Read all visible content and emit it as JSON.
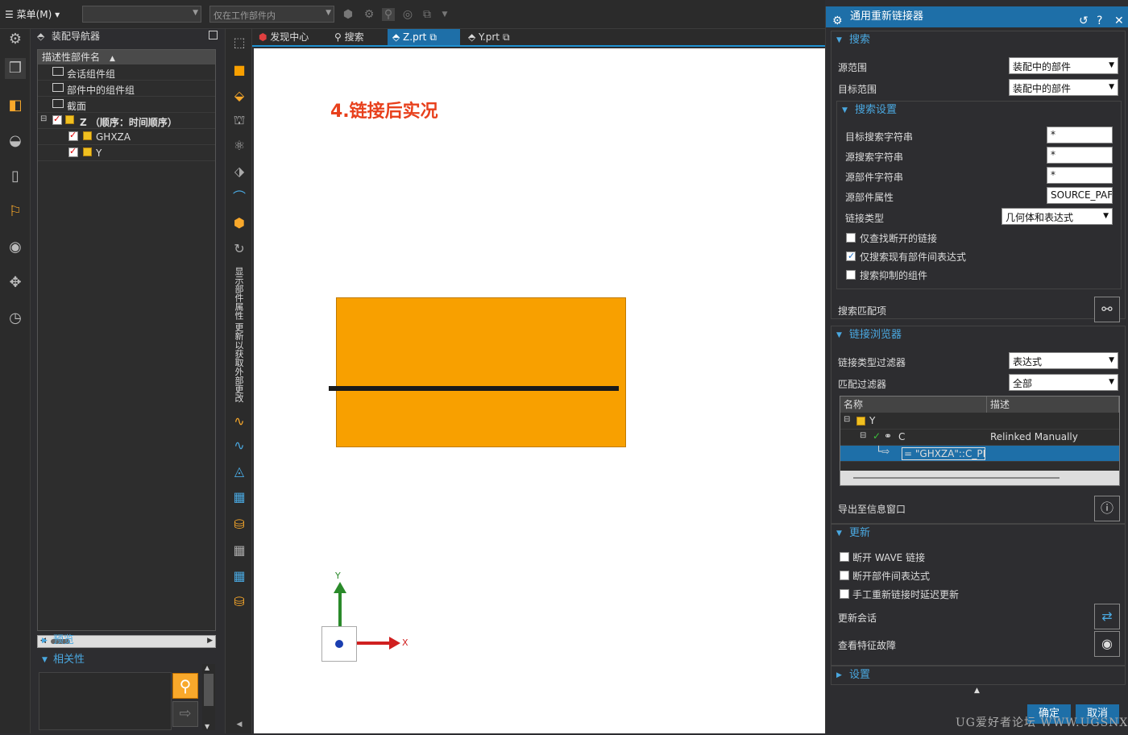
{
  "topbar": {
    "menu_label": "☰ 菜单(M) ▾",
    "filter1_value": "",
    "filter2_value": "仅在工作部件内"
  },
  "navigator": {
    "title": "装配导航器",
    "column_header": "描述性部件名",
    "rows": [
      {
        "label": "会话组件组"
      },
      {
        "label": "部件中的组件组"
      },
      {
        "label": "截面"
      },
      {
        "label": "Z （顺序：时间顺序）"
      },
      {
        "label": "GHXZA"
      },
      {
        "label": "Y"
      }
    ],
    "preview_label": "预览",
    "dependency_label": "相关性"
  },
  "vertical_toolbar": {
    "text": "显示部件属性 更新以获取外部更改"
  },
  "tabs": [
    {
      "label": "发现中心"
    },
    {
      "label": "搜索"
    },
    {
      "label": "Z.prt"
    },
    {
      "label": "Y.prt"
    }
  ],
  "canvas": {
    "heading": "4.链接后实况",
    "axis_x": "X",
    "axis_y": "Y"
  },
  "dialog": {
    "title": "通用重新链接器",
    "search": {
      "header": "搜索",
      "source_scope_label": "源范围",
      "source_scope_value": "装配中的部件",
      "target_scope_label": "目标范围",
      "target_scope_value": "装配中的部件",
      "settings_header": "搜索设置",
      "target_search_label": "目标搜索字符串",
      "target_search_value": "*",
      "source_search_label": "源搜索字符串",
      "source_search_value": "*",
      "source_part_label": "源部件字符串",
      "source_part_value": "*",
      "source_attr_label": "源部件属性",
      "source_attr_value": "SOURCE_PAF",
      "link_type_label": "链接类型",
      "link_type_value": "几何体和表达式",
      "chk_broken": "仅查找断开的链接",
      "chk_existing": "仅搜索现有部件间表达式",
      "chk_suppressed": "搜索抑制的组件",
      "match_label": "搜索匹配项"
    },
    "browser": {
      "header": "链接浏览器",
      "type_filter_label": "链接类型过滤器",
      "type_filter_value": "表达式",
      "match_filter_label": "匹配过滤器",
      "match_filter_value": "全部",
      "col_name": "名称",
      "col_desc": "描述",
      "row1_name": "Y",
      "row2_name": "C",
      "row2_desc": "Relinked Manually",
      "row3_name": "= \"GHXZA\"::C_PI",
      "export_label": "导出至信息窗口"
    },
    "update": {
      "header": "更新",
      "chk_wave": "断开 WAVE 链接",
      "chk_expr": "断开部件间表达式",
      "chk_delay": "手工重新链接时延迟更新",
      "session_label": "更新会话",
      "feature_label": "查看特征故障"
    },
    "settings_header": "设置",
    "ok": "确定",
    "cancel": "取消"
  },
  "watermark": "UG爱好者论坛 WWW.UGSNX.COM"
}
